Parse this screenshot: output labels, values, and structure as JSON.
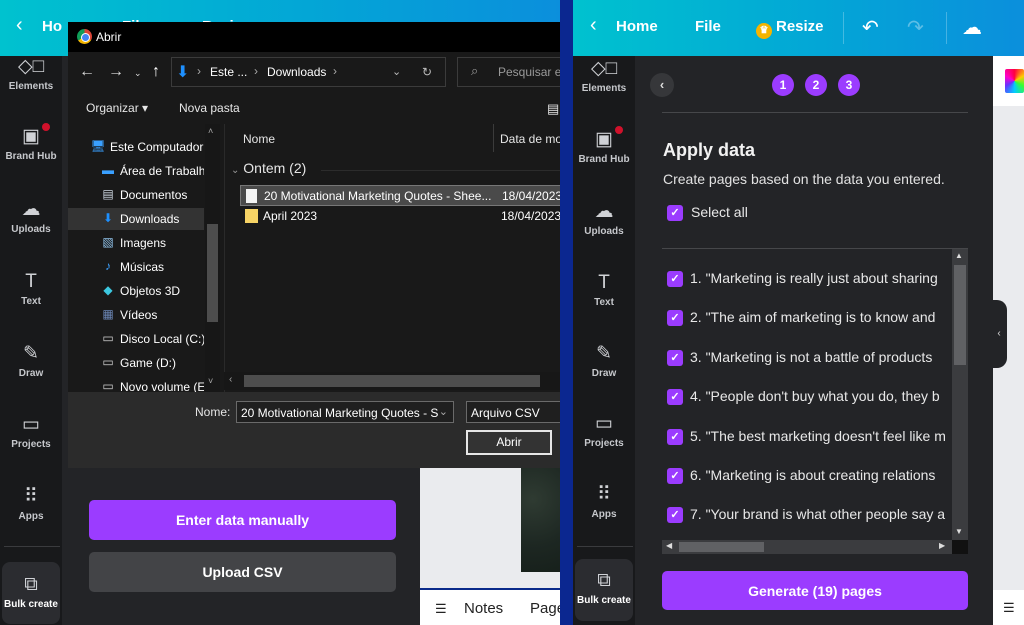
{
  "left": {
    "topbar": {
      "home": "Ho",
      "file": "File",
      "resize": "Resize"
    },
    "sidebar": [
      {
        "icon": "elements-icon",
        "label": "Elements"
      },
      {
        "icon": "brand-hub-icon",
        "label": "Brand Hub",
        "badge": true
      },
      {
        "icon": "uploads-icon",
        "label": "Uploads"
      },
      {
        "icon": "text-icon",
        "label": "Text"
      },
      {
        "icon": "draw-icon",
        "label": "Draw"
      },
      {
        "icon": "projects-icon",
        "label": "Projects"
      },
      {
        "icon": "apps-icon",
        "label": "Apps"
      },
      {
        "icon": "bulk-create-icon",
        "label": "Bulk create",
        "active": true
      }
    ],
    "panel": {
      "enter_manually": "Enter data manually",
      "upload_csv": "Upload CSV"
    },
    "footer": {
      "notes": "Notes",
      "pages": "Page"
    }
  },
  "dialog": {
    "title": "Abrir",
    "breadcrumb": [
      "Este ...",
      "Downloads"
    ],
    "search_placeholder": "Pesquisar em",
    "organize": "Organizar ▾",
    "new_folder": "Nova pasta",
    "tree": [
      {
        "icon": "computer-icon",
        "label": "Este Computador",
        "indent": 0
      },
      {
        "icon": "desktop-icon",
        "label": "Área de Trabalho",
        "indent": 1
      },
      {
        "icon": "documents-icon",
        "label": "Documentos",
        "indent": 1
      },
      {
        "icon": "downloads-icon",
        "label": "Downloads",
        "indent": 1,
        "selected": true
      },
      {
        "icon": "images-icon",
        "label": "Imagens",
        "indent": 1
      },
      {
        "icon": "music-icon",
        "label": "Músicas",
        "indent": 1
      },
      {
        "icon": "3d-objects-icon",
        "label": "Objetos 3D",
        "indent": 1
      },
      {
        "icon": "videos-icon",
        "label": "Vídeos",
        "indent": 1
      },
      {
        "icon": "drive-icon",
        "label": "Disco Local (C:)",
        "indent": 1
      },
      {
        "icon": "drive-icon",
        "label": "Game (D:)",
        "indent": 1
      },
      {
        "icon": "drive-icon",
        "label": "Novo volume (E:)",
        "indent": 1
      }
    ],
    "columns": {
      "name": "Nome",
      "date": "Data de modificação"
    },
    "group": "Ontem (2)",
    "files": [
      {
        "type": "file",
        "name": "20 Motivational Marketing Quotes - Shee...",
        "date": "18/04/2023",
        "selected": true
      },
      {
        "type": "folder",
        "name": "April 2023",
        "date": "18/04/2023"
      }
    ],
    "name_label": "Nome:",
    "name_value": "20 Motivational Marketing Quotes - S",
    "file_type": "Arquivo CSV",
    "open_button": "Abrir"
  },
  "right": {
    "topbar": {
      "home": "Home",
      "file": "File",
      "resize": "Resize"
    },
    "steps": [
      "1",
      "2",
      "3"
    ],
    "title": "Apply data",
    "subtitle": "Create pages based on the data you entered.",
    "select_all": "Select all",
    "rows": [
      "1. \"Marketing is really just about sharing",
      "2. \"The aim of marketing is to know and",
      "3. \"Marketing is not a battle of products",
      "4. \"People don't buy what you do, they b",
      "5. \"The best marketing doesn't feel like m",
      "6. \"Marketing is about creating relations",
      "7. \"Your brand is what other people say a"
    ],
    "generate": "Generate (19) pages"
  },
  "colors": {
    "accent": "#9b3cff",
    "topbar_start": "#00c2cf",
    "topbar_end": "#0b8fdc",
    "panel": "#232427",
    "sidebar": "#18191b"
  }
}
